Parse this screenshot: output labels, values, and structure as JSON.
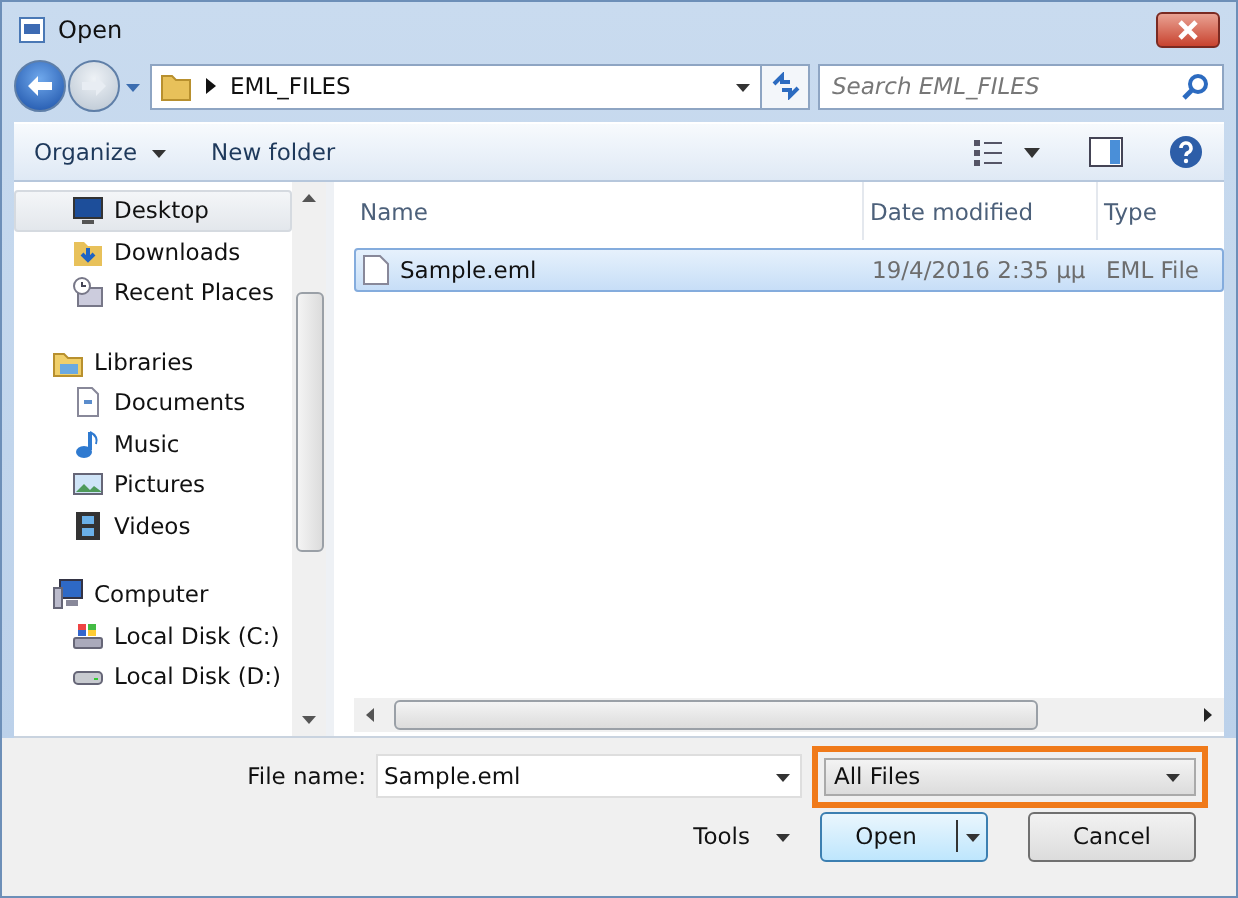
{
  "window": {
    "title": "Open"
  },
  "address": {
    "path": "EML_FILES"
  },
  "search": {
    "placeholder": "Search EML_FILES"
  },
  "toolbar": {
    "items": [
      "Organize",
      "New folder"
    ]
  },
  "sidebar": {
    "groups": [
      {
        "children": [
          {
            "label": "Desktop",
            "kind": "desktop",
            "selected": true
          },
          {
            "label": "Downloads",
            "kind": "downloads",
            "selected": false
          },
          {
            "label": "Recent Places",
            "kind": "recent",
            "selected": false
          }
        ]
      },
      {
        "label": "Libraries",
        "kind": "libraries",
        "children": [
          {
            "label": "Documents",
            "kind": "documents",
            "selected": false
          },
          {
            "label": "Music",
            "kind": "music",
            "selected": false
          },
          {
            "label": "Pictures",
            "kind": "pictures",
            "selected": false
          },
          {
            "label": "Videos",
            "kind": "videos",
            "selected": false
          }
        ]
      },
      {
        "label": "Computer",
        "kind": "computer",
        "children": [
          {
            "label": "Local Disk (C:)",
            "kind": "system-disk",
            "selected": false
          },
          {
            "label": "Local Disk (D:)",
            "kind": "disk",
            "selected": false
          }
        ]
      }
    ]
  },
  "table": {
    "columns": [
      "Name",
      "Date modified",
      "Type"
    ],
    "rows": [
      {
        "cells": [
          "Sample.eml",
          "19/4/2016 2:35 μμ",
          "EML File"
        ],
        "selected": true
      }
    ]
  },
  "file_name": {
    "label": "File name:",
    "value": "Sample.eml"
  },
  "file_type": {
    "value": "All Files",
    "highlighted": true
  },
  "buttons": [
    {
      "label": "Tools",
      "kind": "menu"
    },
    {
      "label": "Open",
      "kind": "split-primary"
    },
    {
      "label": "Cancel",
      "kind": "plain"
    }
  ]
}
